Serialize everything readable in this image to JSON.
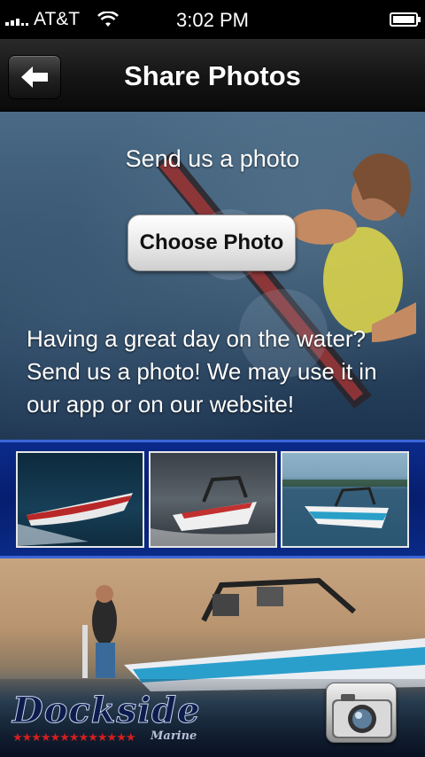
{
  "status_bar": {
    "carrier": "AT&T",
    "time": "3:02 PM",
    "signal_icon": "signal-bars-icon",
    "wifi_icon": "wifi-icon",
    "battery_icon": "battery-icon"
  },
  "nav": {
    "title": "Share Photos",
    "back_icon": "back-arrow-icon"
  },
  "hero": {
    "heading": "Send us a photo",
    "button_label": "Choose Photo",
    "body": "Having a great day on the water? Send us a photo! We may use it in our app or on our website!"
  },
  "thumbnails": [
    {
      "name": "boat-photo-1"
    },
    {
      "name": "boat-photo-2"
    },
    {
      "name": "boat-photo-3"
    }
  ],
  "banner": {
    "logo_text": "Dockside",
    "logo_stars": "★★★★★★★★★★★★★",
    "logo_sub": "Marine",
    "camera_icon": "camera-icon"
  },
  "colors": {
    "strip_blue": "#061e6e",
    "strip_border": "#3a66d8",
    "logo_red": "#d41e1e"
  }
}
